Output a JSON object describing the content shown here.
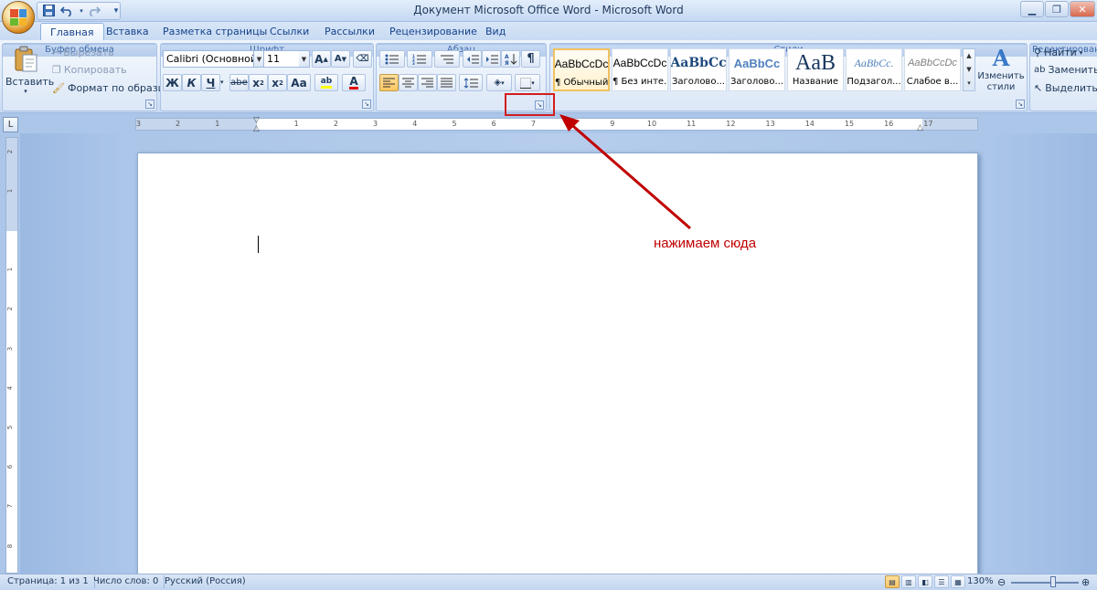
{
  "window": {
    "title": "Документ Microsoft Office Word - Microsoft Word"
  },
  "qat": {
    "save_icon": "save-icon",
    "undo_icon": "undo-icon",
    "redo_icon": "redo-icon",
    "customize": "▾"
  },
  "tabs": [
    {
      "label": "Главная",
      "active": true
    },
    {
      "label": "Вставка"
    },
    {
      "label": "Разметка страницы"
    },
    {
      "label": "Ссылки"
    },
    {
      "label": "Рассылки"
    },
    {
      "label": "Рецензирование"
    },
    {
      "label": "Вид"
    }
  ],
  "clipboard": {
    "paste_label": "Вставить",
    "cut_label": "Вырезать",
    "copy_label": "Копировать",
    "format_painter_label": "Формат по образцу",
    "group_label": "Буфер обмена"
  },
  "font": {
    "font_name": "Calibri (Основной те",
    "font_size": "11",
    "grow": "A",
    "shrink": "A",
    "bold": "Ж",
    "italic": "К",
    "underline": "Ч",
    "strike": "abe",
    "subscript": "x",
    "superscript": "x",
    "case": "Aa",
    "highlight": "ab",
    "color": "A",
    "group_label": "Шрифт"
  },
  "paragraph": {
    "group_label": "Абзац",
    "pilcrow": "¶"
  },
  "styles": {
    "group_label": "Стили",
    "items": [
      {
        "preview": "AaBbCcDc",
        "name": "¶ Обычный",
        "selected": true
      },
      {
        "preview": "AaBbCcDc",
        "name": "¶ Без инте..."
      },
      {
        "preview": "AaBbCc",
        "name": "Заголово..."
      },
      {
        "preview": "AaBbCc",
        "name": "Заголово..."
      },
      {
        "preview": "AaB",
        "name": "Название"
      },
      {
        "preview": "AaBbCc.",
        "name": "Подзагол..."
      },
      {
        "preview": "AaBbCcDc",
        "name": "Слабое в..."
      }
    ],
    "change_styles_label": "Изменить стили"
  },
  "editing": {
    "group_label": "Редактирование",
    "find_label": "Найти",
    "replace_label": "Заменить",
    "select_label": "Выделить"
  },
  "ruler": {
    "numbers": [
      "3",
      "2",
      "1",
      "1",
      "2",
      "3",
      "4",
      "5",
      "6",
      "7",
      "8",
      "9",
      "10",
      "11",
      "12",
      "13",
      "14",
      "15",
      "16",
      "17"
    ]
  },
  "vruler": {
    "numbers": [
      "2",
      "1",
      "1",
      "2",
      "3",
      "4",
      "5",
      "6",
      "7",
      "8"
    ]
  },
  "status": {
    "page": "Страница: 1 из 1",
    "words": "Число слов: 0",
    "language": "Русский (Россия)",
    "zoom": "130%"
  },
  "annotation": {
    "text": "нажимаем сюда",
    "color": "#c00000"
  }
}
